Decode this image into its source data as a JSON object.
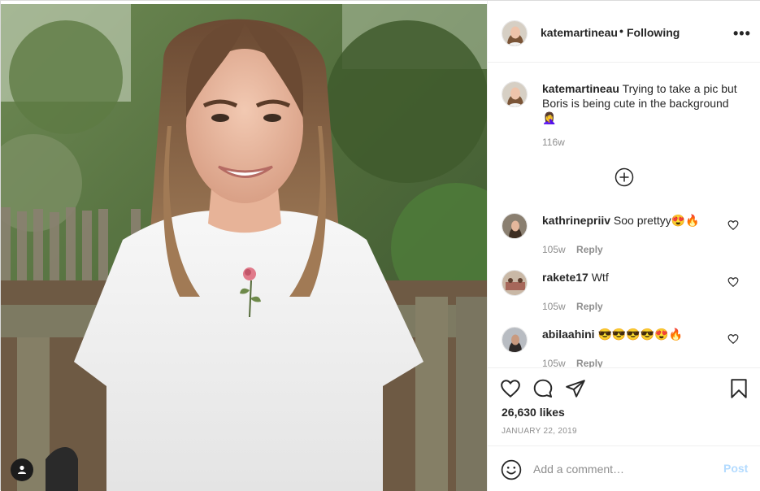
{
  "header": {
    "username": "katemartineau",
    "separator": "•",
    "follow_status": "Following",
    "more_label": "•••"
  },
  "caption": {
    "username": "katemartineau",
    "text": "Trying to take a pic but Boris is being cute in the background 🤦‍♀️",
    "time": "116w"
  },
  "comments": [
    {
      "username": "kathrinepriiv",
      "text": "Soo prettyy😍🔥",
      "time": "105w",
      "reply_label": "Reply"
    },
    {
      "username": "rakete17",
      "text": "Wtf",
      "time": "105w",
      "reply_label": "Reply"
    },
    {
      "username": "abilaahini",
      "text": "😎😎😎😎😍🔥",
      "time": "105w",
      "reply_label": "Reply"
    }
  ],
  "stats": {
    "likes": "26,630 likes",
    "date": "JANUARY 22, 2019"
  },
  "composer": {
    "placeholder": "Add a comment…",
    "post_label": "Post"
  },
  "icons": {
    "more": "more-options-icon",
    "load_more": "plus-circle-icon",
    "like": "heart-icon",
    "comment": "comment-bubble-icon",
    "share": "paper-plane-icon",
    "save": "bookmark-icon",
    "emoji": "smiley-icon",
    "tagged_user": "user-tag-icon"
  },
  "colors": {
    "primary_text": "#262626",
    "secondary_text": "#8e8e8e",
    "divider": "#efefef",
    "post_button_disabled": "#b3dbff"
  }
}
